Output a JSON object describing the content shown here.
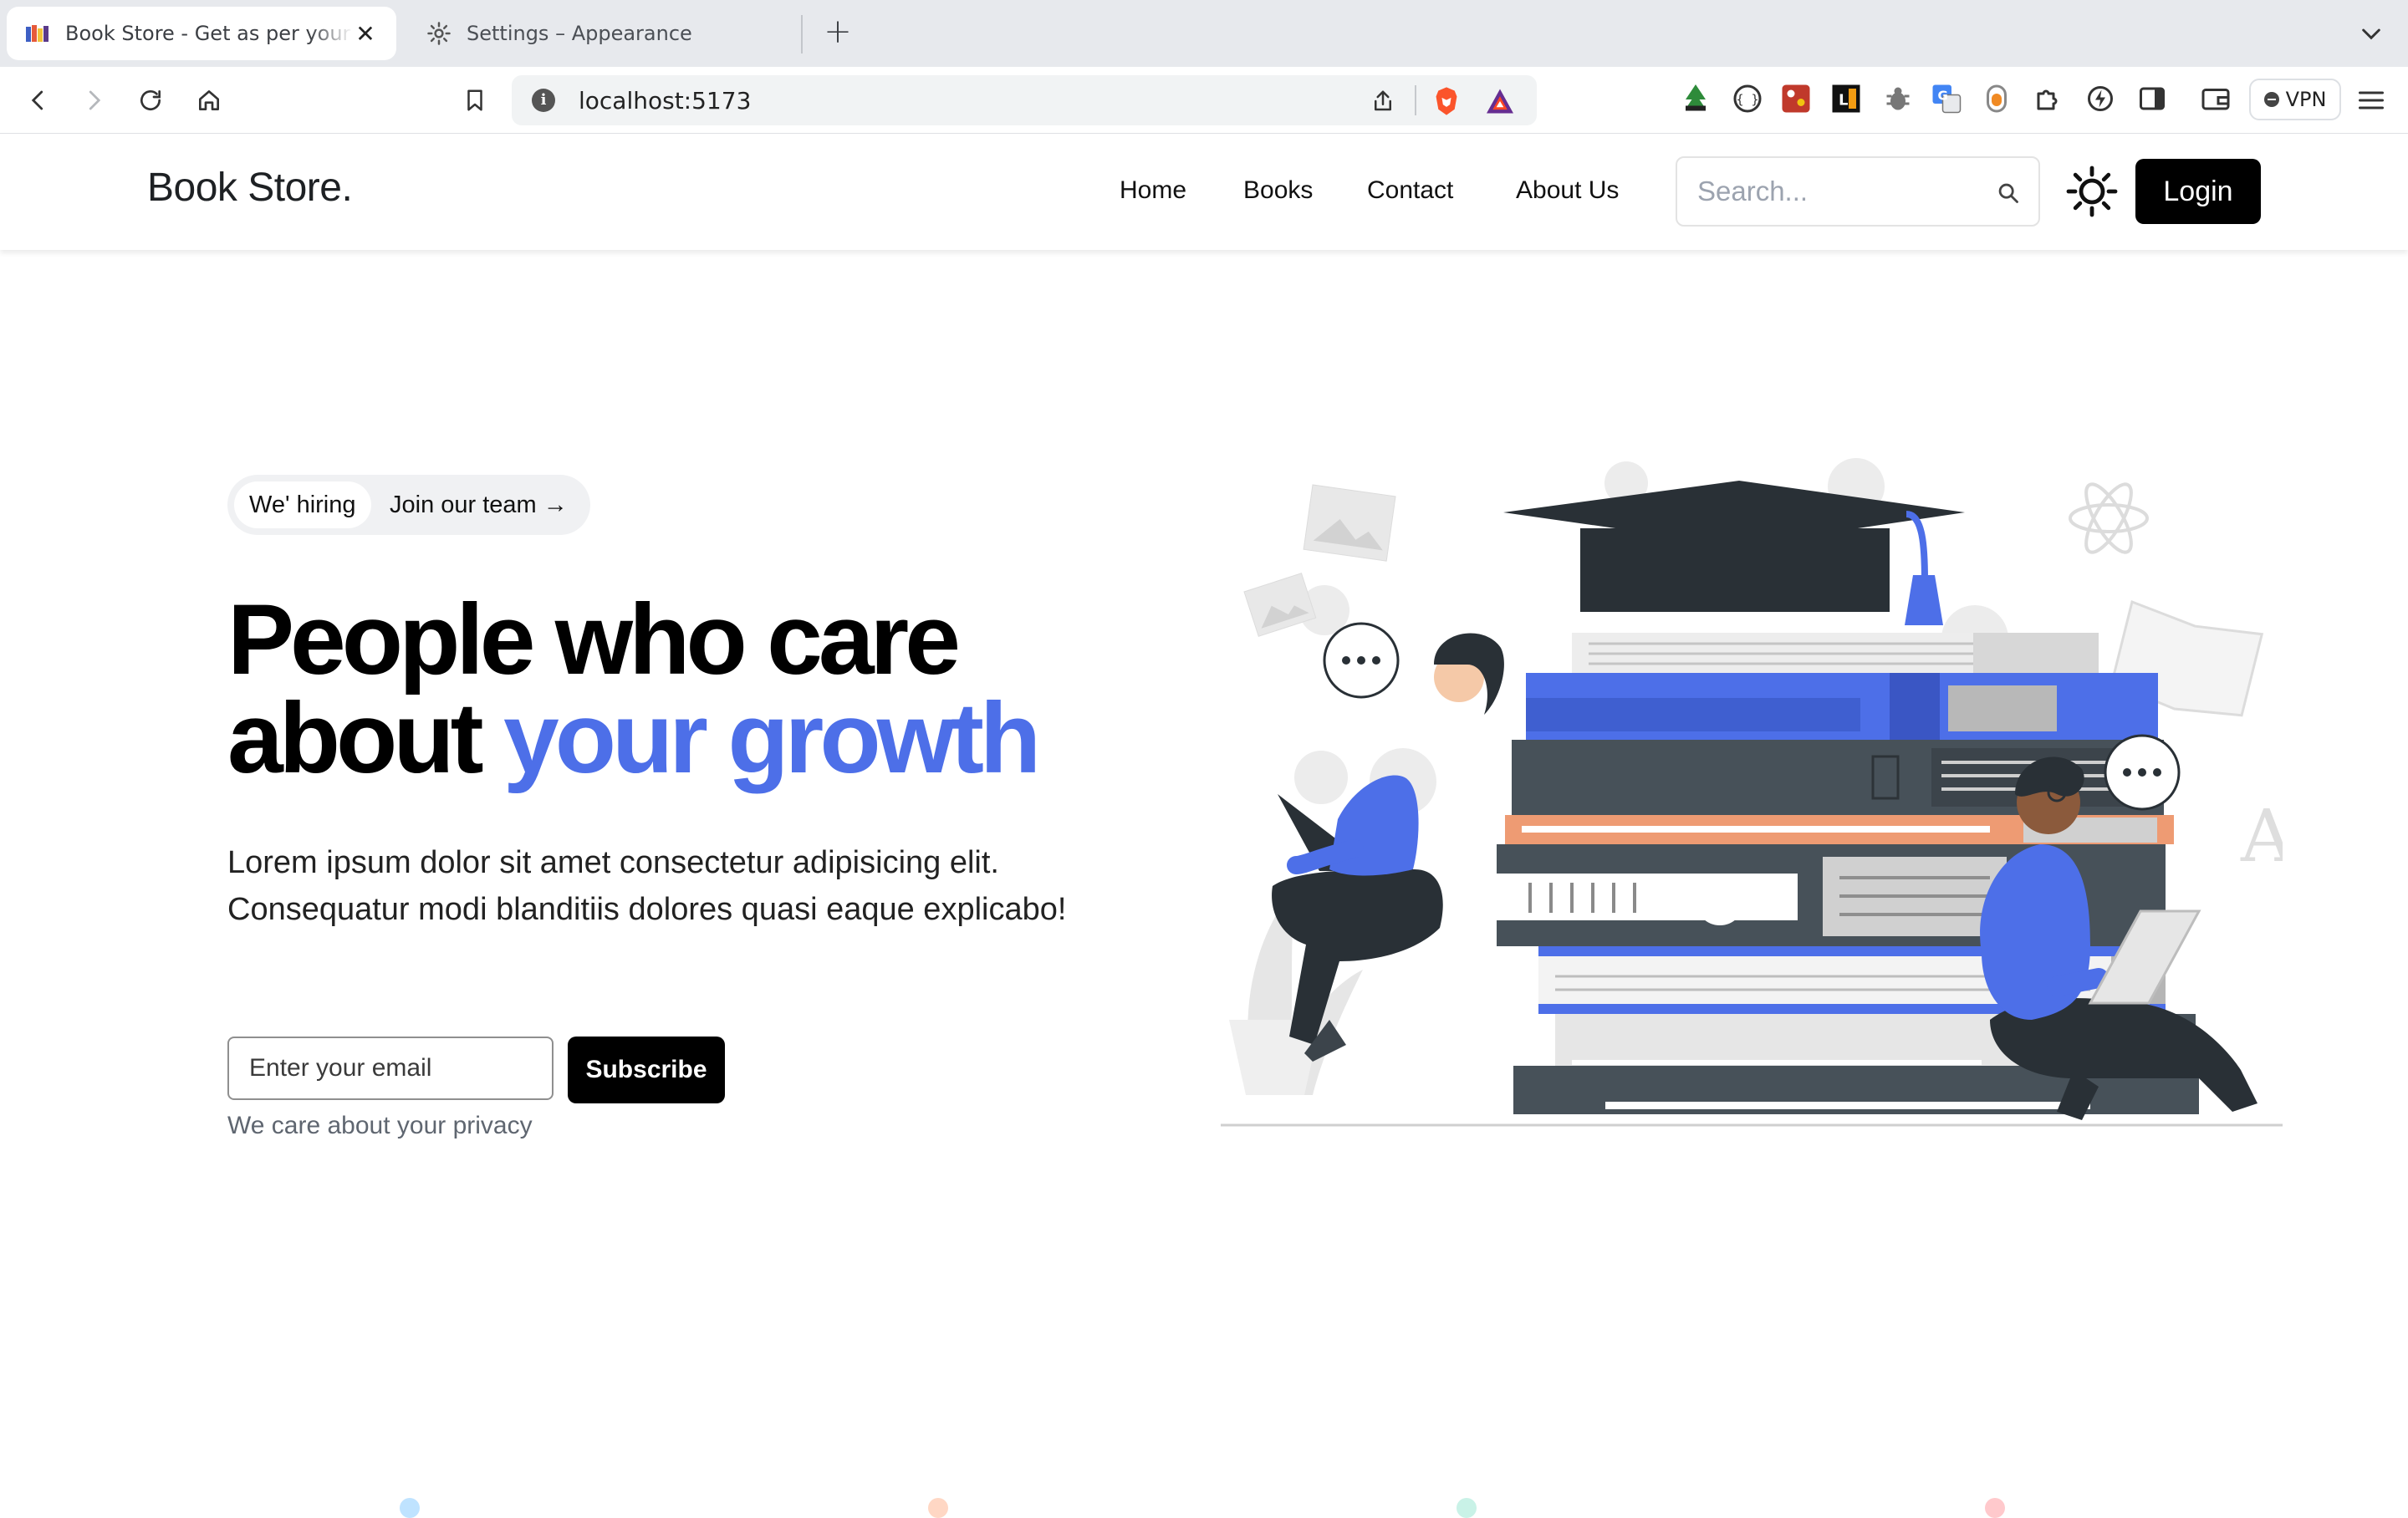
{
  "browser": {
    "tabs": [
      {
        "title": "Book Store - Get as per your need",
        "active": true
      },
      {
        "title": "Settings – Appearance",
        "active": false
      }
    ],
    "address": "localhost:5173",
    "vpn_label": "VPN",
    "extensions": [
      "html-validator-icon",
      "json-viewer-icon",
      "color-picker-icon",
      "lighthouse-icon",
      "bug-icon",
      "translate-icon",
      "gradient-icon",
      "extensions-icon",
      "performance-icon",
      "sidebar-icon",
      "wallet-icon"
    ]
  },
  "site": {
    "brand": "Book Store.",
    "nav": [
      "Home",
      "Books",
      "Contact",
      "About Us"
    ],
    "search_placeholder": "Search...",
    "login_label": "Login"
  },
  "hero": {
    "pill_badge": "We' hiring",
    "pill_link": "Join our team →",
    "headline_line1": "People who care",
    "headline_line2_plain": "about ",
    "headline_line2_accent": "your growth",
    "lead": "Lorem ipsum dolor sit amet consectetur adipisicing elit. Consequatur modi blanditiis dolores quasi eaque explicabo!",
    "email_placeholder": "Enter your email",
    "subscribe_label": "Subscribe",
    "privacy": "We care about your privacy"
  },
  "colors": {
    "accent": "#4d6fe8",
    "dark": "#000000",
    "book_dark": "#475159",
    "book_orange": "#ee9b73"
  }
}
